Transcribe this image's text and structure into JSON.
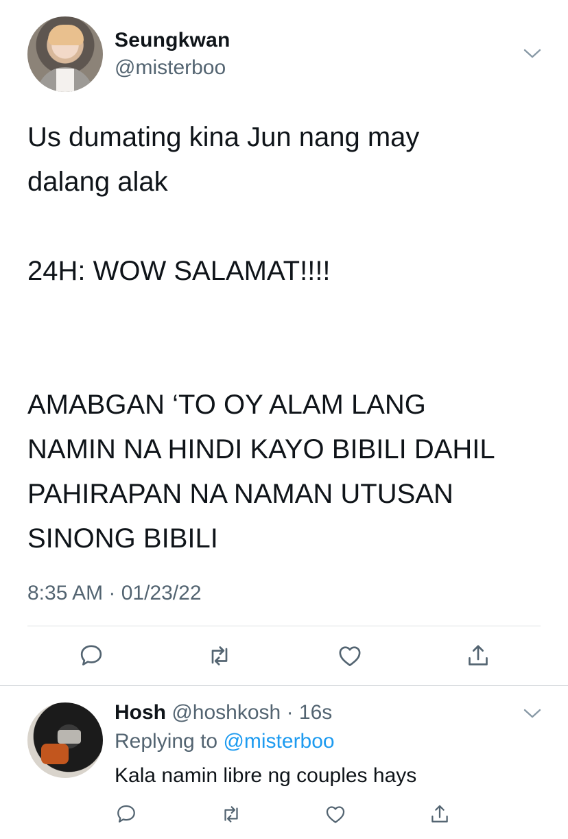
{
  "main_tweet": {
    "author_name": "Seungkwan",
    "author_handle": "@misterboo",
    "text": "Us dumating kina Jun nang may\ndalang alak\n\n24H: WOW SALAMAT!!!!\n\n\nAMABGAN ‘TO OY ALAM LANG\nNAMIN NA HINDI KAYO BIBILI DAHIL\nPAHIRAPAN NA NAMAN UTUSAN\nSINONG BIBILI",
    "timestamp": "8:35 AM · 01/23/22",
    "actions": [
      "reply-icon",
      "retweet-icon",
      "like-icon",
      "share-icon"
    ]
  },
  "reply_tweet": {
    "author_name": "Hosh",
    "author_handle": "@hoshkosh",
    "separator": " · ",
    "age": "16s",
    "replying_prefix": "Replying to ",
    "replying_handle": "@misterboo",
    "text": "Kala namin libre ng couples hays",
    "actions": [
      "reply-icon",
      "retweet-icon",
      "like-icon",
      "share-icon"
    ]
  },
  "colors": {
    "text": "#0f1419",
    "secondary": "#536471",
    "link": "#1d9bf0",
    "divider": "#dcdfe2"
  }
}
